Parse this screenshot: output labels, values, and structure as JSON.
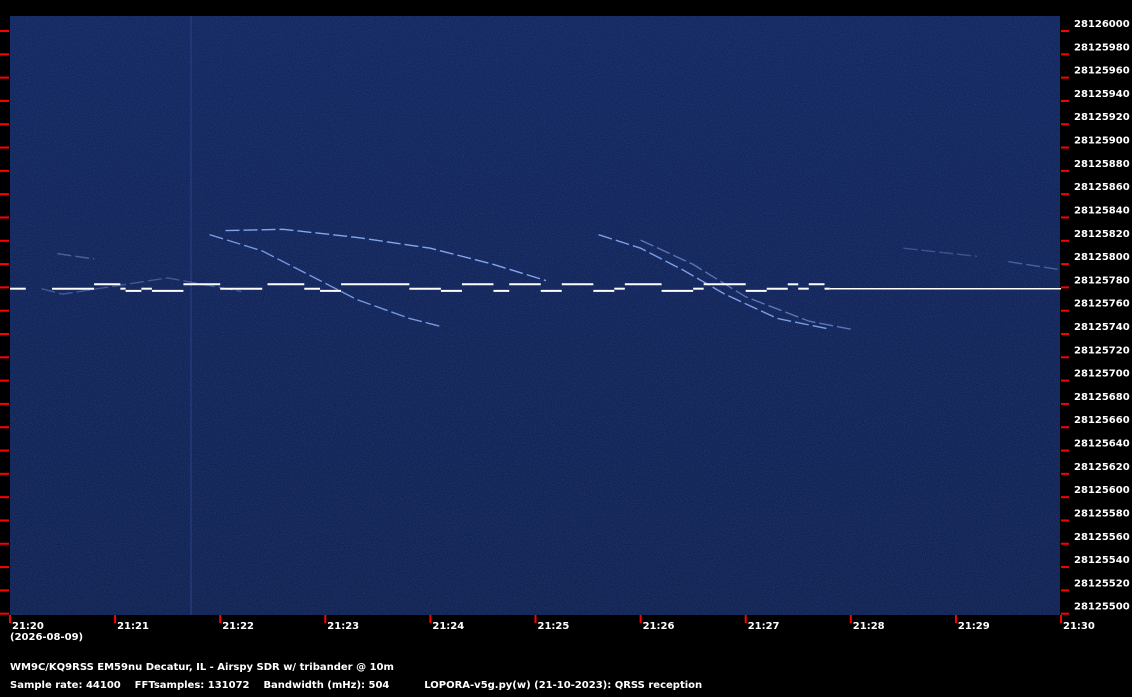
{
  "date_label": "(2026-08-09)",
  "footer": {
    "station": "WM9C/KQ9RSS EM59nu Decatur, IL - Airspy SDR w/ tribander @ 10m",
    "sample_rate": "Sample rate: 44100",
    "fft_samples": "FFTsamples: 131072",
    "bandwidth": "Bandwidth (mHz): 504",
    "software": "LOPORA-v5g.py(w) (21-10-2023): QRSS reception"
  },
  "colors": {
    "background": "#0b1a4a",
    "trace": "#ffffff",
    "tick": "#ff0000"
  },
  "chart_data": {
    "type": "heatmap",
    "title": "",
    "xlabel": "",
    "ylabel": "",
    "x_ticks": [
      "21:20",
      "21:21",
      "21:22",
      "21:23",
      "21:24",
      "21:25",
      "21:26",
      "21:27",
      "21:28",
      "21:29",
      "21:30"
    ],
    "y_ticks": [
      28126000,
      28125980,
      28125960,
      28125940,
      28125920,
      28125900,
      28125880,
      28125860,
      28125840,
      28125820,
      28125800,
      28125780,
      28125760,
      28125740,
      28125720,
      28125700,
      28125680,
      28125660,
      28125640,
      28125620,
      28125600,
      28125580,
      28125560,
      28125540,
      28125520,
      28125500
    ],
    "ylim": [
      28125492,
      28126006
    ],
    "carrier_frequency": 28125772,
    "signal_segments": [
      {
        "t0": "21:20",
        "t1": "21:27.8",
        "kind": "keyed-carrier"
      },
      {
        "t0": "21:27.8",
        "t1": "21:30",
        "kind": "steady-carrier"
      }
    ]
  }
}
